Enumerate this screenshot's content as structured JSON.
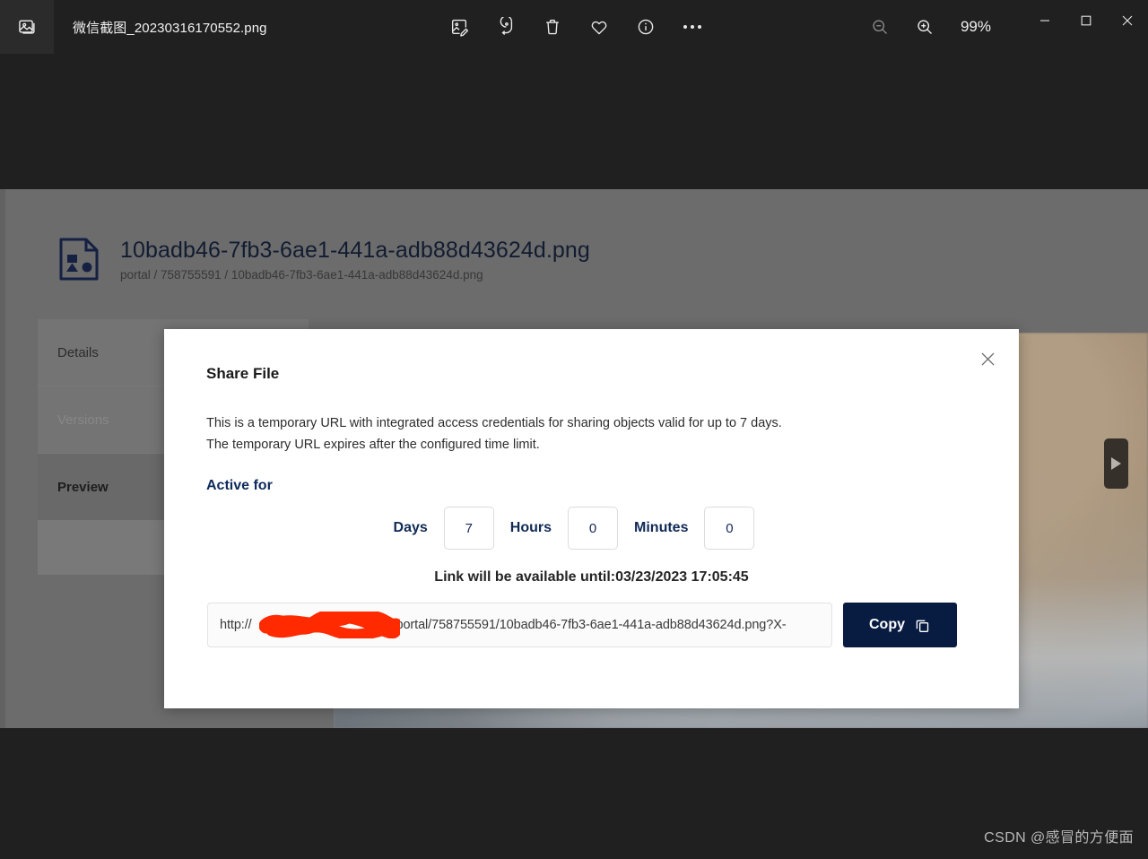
{
  "window": {
    "app_icon": "photo-icon",
    "file_title": "微信截图_20230316170552.png",
    "zoom_level": "99%",
    "toolbar": [
      {
        "name": "edit-image-icon",
        "label": "Edit image"
      },
      {
        "name": "rotate-icon",
        "label": "Rotate"
      },
      {
        "name": "delete-icon",
        "label": "Delete"
      },
      {
        "name": "favorite-icon",
        "label": "Add to favorites"
      },
      {
        "name": "info-icon",
        "label": "File info"
      },
      {
        "name": "more-options-icon",
        "label": "See more"
      }
    ],
    "zoom_out_icon": "zoom-out-icon",
    "zoom_in_icon": "zoom-in-icon",
    "controls": {
      "minimize": "minimize-icon",
      "maximize": "maximize-icon",
      "close": "close-icon"
    }
  },
  "content": {
    "file": {
      "icon": "image-file-icon",
      "name": "10badb46-7fb3-6ae1-441a-adb88d43624d.png",
      "path": "portal / 758755591 / 10badb46-7fb3-6ae1-441a-adb88d43624d.png"
    },
    "tabs": [
      {
        "label": "Details",
        "state": "normal"
      },
      {
        "label": "Versions",
        "state": "disabled"
      },
      {
        "label": "Preview",
        "state": "active"
      }
    ],
    "preview": {
      "next_arrow_icon": "next-arrow-icon"
    }
  },
  "modal": {
    "close_icon": "close-icon",
    "title": "Share File",
    "description_line1": "This is a temporary URL with integrated access credentials for sharing objects valid for up to 7 days.",
    "description_line2": "The temporary URL expires after the configured time limit.",
    "active_for_label": "Active for",
    "duration": [
      {
        "label": "Days",
        "value": "7"
      },
      {
        "label": "Hours",
        "value": "0"
      },
      {
        "label": "Minutes",
        "value": "0"
      }
    ],
    "until_text": "Link will be available until:03/23/2023 17:05:45",
    "url_prefix": "http://",
    "url_suffix": "/portal/758755591/10badb46-7fb3-6ae1-441a-adb88d43624d.png?X-",
    "copy_label": "Copy",
    "copy_icon": "copy-icon",
    "accent_color": "#081C42",
    "redaction_color": "#FF2A00"
  },
  "watermark": "CSDN @感冒的方便面"
}
